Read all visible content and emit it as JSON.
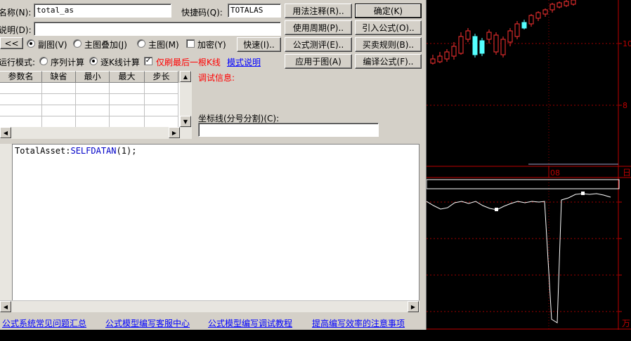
{
  "form": {
    "name_label": "名称(N):",
    "name_value": "total_as",
    "hotkey_label": "快捷码(Q):",
    "hotkey_value": "TOTALAS",
    "desc_label": "说明(D):",
    "desc_value": "",
    "collapse_button": "<<",
    "radio_subchart": "副图(V)",
    "radio_main_overlay": "主图叠加(J)",
    "radio_main": "主图(M)",
    "check_encrypt": "加密(Y)",
    "quick_button": "快速(I)..",
    "run_mode_label": "运行模式:",
    "radio_sequence": "序列计算",
    "radio_each": "逐K线计算",
    "check_last_only": "仅刷最后一根K线",
    "mode_help_link": "模式说明",
    "debug_label": "调试信息:",
    "axis_label": "坐标线(分号分割)(C):",
    "axis_value": ""
  },
  "buttons": {
    "usage_notes": "用法注释(R)..",
    "ok": "确定(K)",
    "usage_period": "使用周期(P)..",
    "import_formula": "引入公式(O)..",
    "formula_test": "公式测评(E)..",
    "trade_rules": "买卖规则(B)..",
    "apply_to_chart": "应用于图(A)",
    "compile": "编译公式(F).."
  },
  "param_table": {
    "headers": [
      "参数名",
      "缺省",
      "最小",
      "最大",
      "步长"
    ]
  },
  "code": {
    "identifier": "TotalAsset",
    "sep": ":",
    "function": "SELFDATAN",
    "args": "(1);"
  },
  "links": {
    "faq": "公式系统常见问题汇总",
    "support": "公式模型编写客服中心",
    "debug_tutorial": "公式模型编写调试教程",
    "tips": "提高编写效率的注意事项"
  },
  "chart": {
    "price_ticks": [
      "10",
      "8"
    ],
    "date_label": "08",
    "side_labels": [
      "日",
      "万"
    ],
    "candle_color_up": "#ff3232",
    "candle_color_down": "#54ffff"
  }
}
